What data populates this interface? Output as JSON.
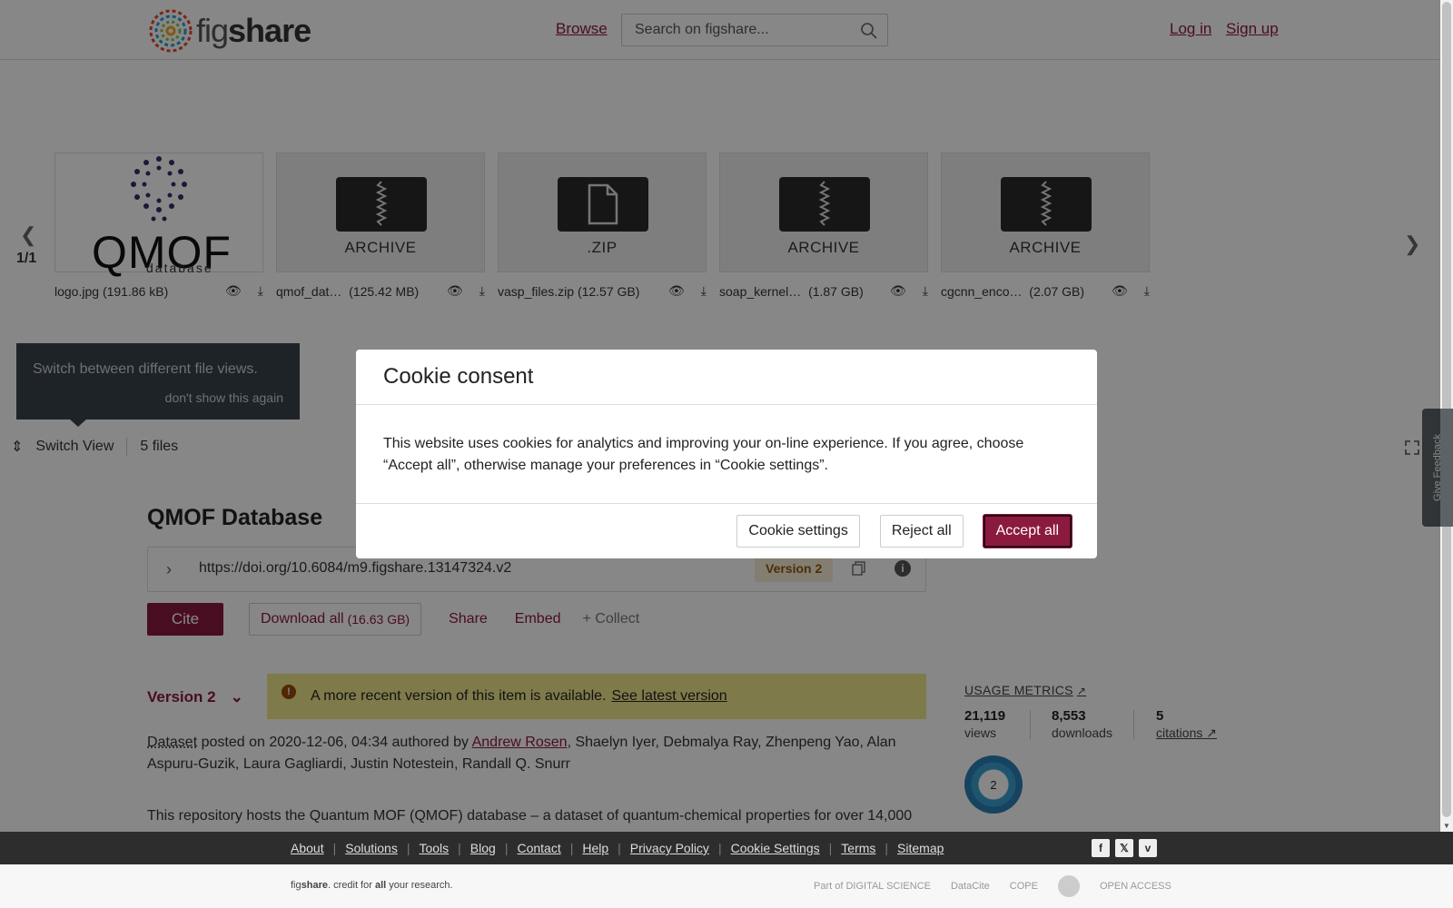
{
  "header": {
    "logo_prefix": "fig",
    "logo_bold": "share",
    "browse": "Browse",
    "search_placeholder": "Search on figshare...",
    "login": "Log in",
    "signup": "Sign up"
  },
  "carousel": {
    "count": "1/1",
    "tiles": [
      {
        "type": "image",
        "logo_text": "QMOF",
        "logo_sub": "database",
        "name": "logo.jpg",
        "size": "(191.86 kB)"
      },
      {
        "type": "archive",
        "label": "ARCHIVE",
        "name": "qmof_dat…",
        "size": "(125.42 MB)"
      },
      {
        "type": "file",
        "label": ".ZIP",
        "name": "vasp_files.zip",
        "size": "(12.57 GB)"
      },
      {
        "type": "archive",
        "label": "ARCHIVE",
        "name": "soap_kernel…",
        "size": "(1.87 GB)"
      },
      {
        "type": "archive",
        "label": "ARCHIVE",
        "name": "cgcnn_enco…",
        "size": "(2.07 GB)"
      }
    ]
  },
  "tip": {
    "text": "Switch between different file views.",
    "dismiss": "don't show this again"
  },
  "viewbar": {
    "switch_view": "Switch View",
    "file_count": "5 files"
  },
  "item": {
    "title": "QMOF Database",
    "doi": "https://doi.org/10.6084/m9.figshare.13147324.v2",
    "version_badge": "Version 2",
    "cite": "Cite",
    "download": "Download all",
    "download_size": "(16.63 GB)",
    "share": "Share",
    "embed": "Embed",
    "collect": "+ Collect",
    "version_select": "Version 2",
    "notice_text": "A more recent version of this item is available.",
    "notice_link": "See latest version",
    "type": "Dataset",
    "posted": " posted on 2020-12-06, 04:34 authored by ",
    "first_author": "Andrew Rosen",
    "other_authors": ", Shaelyn Iyer, Debmalya Ray, Zhenpeng Yao, Alan Aspuru-Guzik, Laura Gagliardi, Justin Notestein, Randall Q. Snurr",
    "description": "This repository hosts the Quantum MOF (QMOF) database – a dataset of quantum-chemical properties for over 14,000"
  },
  "metrics": {
    "title": "USAGE METRICS",
    "views_value": "21,119",
    "views_label": "views",
    "downloads_value": "8,553",
    "downloads_label": "downloads",
    "citations_value": "5",
    "citations_label": "citations",
    "altmetric_score": "2"
  },
  "feedback": "Give Feedback",
  "footer": {
    "links": [
      "About",
      "Solutions",
      "Tools",
      "Blog",
      "Contact",
      "Help",
      "Privacy Policy",
      "Cookie Settings",
      "Terms",
      "Sitemap"
    ],
    "tagline_prefix": "fig",
    "tagline_bold": "share",
    "tagline_mid": ". credit for ",
    "tagline_all": "all",
    "tagline_end": " your research.",
    "partners": [
      "Part of DIGITAL SCIENCE",
      "DataCite",
      "COPE",
      "",
      "OPEN ACCESS"
    ]
  },
  "cookie": {
    "title": "Cookie consent",
    "body": "This website uses cookies for analytics and improving your on-line experience. If you agree, choose “Accept all”, otherwise manage your preferences in “Cookie settings”.",
    "settings": "Cookie settings",
    "reject": "Reject all",
    "accept": "Accept all"
  },
  "colors": {
    "brand": "#8b1a3f",
    "notice_bg": "#efe68d",
    "badge_bg": "#f9ecd6",
    "footer_dark": "#2d2d2d"
  }
}
